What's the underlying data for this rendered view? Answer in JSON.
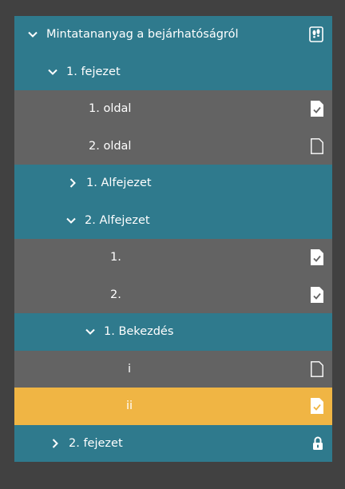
{
  "tree": {
    "root": {
      "label": "Mintatananyag a bejárhatóságról",
      "icon": "footprints-icon",
      "expanded": true
    },
    "chapter1": {
      "label": "1. fejezet",
      "expanded": true
    },
    "ch1_page1": {
      "label": "1. oldal",
      "icon": "page-checked-icon"
    },
    "ch1_page2": {
      "label": "2. oldal",
      "icon": "page-empty-icon"
    },
    "sub1": {
      "label": "1. Alfejezet",
      "expanded": false
    },
    "sub2": {
      "label": "2. Alfejezet",
      "expanded": true
    },
    "sub2_item1": {
      "label": "1.",
      "icon": "page-checked-icon"
    },
    "sub2_item2": {
      "label": "2.",
      "icon": "page-checked-icon"
    },
    "paragraph1": {
      "label": "1. Bekezdés",
      "expanded": true
    },
    "para_i": {
      "label": "i",
      "icon": "page-empty-icon"
    },
    "para_ii": {
      "label": "ii",
      "icon": "page-checked-icon",
      "selected": true
    },
    "chapter2": {
      "label": "2. fejezet",
      "icon": "lock-icon",
      "expanded": false
    }
  },
  "colors": {
    "background": "#414141",
    "section": "#2f7a8d",
    "page": "#636363",
    "selected": "#f0b544"
  }
}
